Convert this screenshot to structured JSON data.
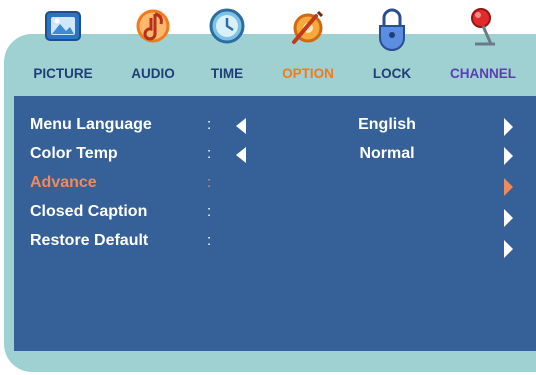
{
  "tabs": [
    {
      "label": "PICTURE",
      "icon": "picture-icon"
    },
    {
      "label": "AUDIO",
      "icon": "audio-icon"
    },
    {
      "label": "TIME",
      "icon": "clock-icon"
    },
    {
      "label": "OPTION",
      "icon": "option-icon"
    },
    {
      "label": "LOCK",
      "icon": "lock-icon"
    },
    {
      "label": "CHANNEL",
      "icon": "channel-icon"
    }
  ],
  "active_tab": "OPTION",
  "menu": {
    "items": [
      {
        "label": "Menu Language",
        "colon": ":",
        "value": "English"
      },
      {
        "label": "Color Temp",
        "colon": ":",
        "value": "Normal"
      },
      {
        "label": "Advance",
        "colon": ":",
        "value": ""
      },
      {
        "label": "Closed Caption",
        "colon": ":",
        "value": ""
      },
      {
        "label": "Restore Default",
        "colon": ":",
        "value": ""
      }
    ],
    "highlighted": "Advance"
  },
  "colors": {
    "panel": "#356198",
    "frame": "#9fd1d3",
    "tab_label": "#1f3e76",
    "active_tab": "#f07a1c",
    "highlight": "#f08a5d"
  }
}
